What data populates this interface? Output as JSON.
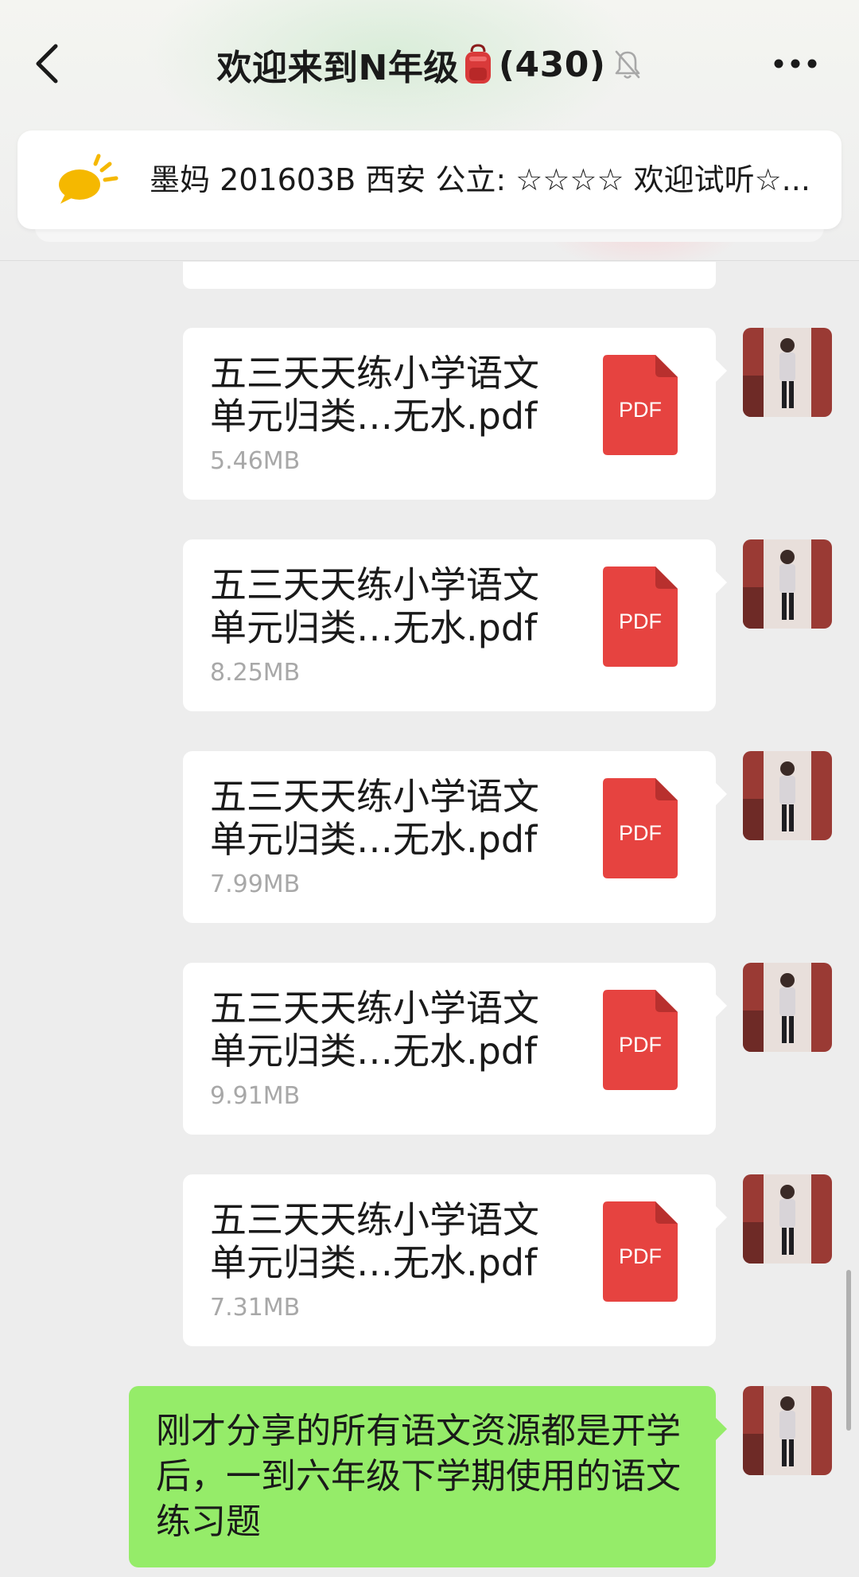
{
  "header": {
    "title": "欢迎来到N年级",
    "member_count": "(430)",
    "back_icon": "chevron-left-icon",
    "bag_icon": "backpack-emoji-icon",
    "mute_icon": "bell-muted-icon",
    "more_icon": "more-dots-icon"
  },
  "notice": {
    "icon": "announcement-bulb-icon",
    "text": "墨妈 201603B 西安 公立: ☆☆☆☆ 欢迎试听☆..."
  },
  "messages": [
    {
      "type": "file",
      "name": "五三天天练小学语文单元归类…无水.pdf",
      "size": "5.46MB",
      "file_icon": "PDF"
    },
    {
      "type": "file",
      "name": "五三天天练小学语文单元归类…无水.pdf",
      "size": "8.25MB",
      "file_icon": "PDF"
    },
    {
      "type": "file",
      "name": "五三天天练小学语文单元归类…无水.pdf",
      "size": "7.99MB",
      "file_icon": "PDF"
    },
    {
      "type": "file",
      "name": "五三天天练小学语文单元归类…无水.pdf",
      "size": "9.91MB",
      "file_icon": "PDF"
    },
    {
      "type": "file",
      "name": "五三天天练小学语文单元归类…无水.pdf",
      "size": "7.31MB",
      "file_icon": "PDF"
    },
    {
      "type": "text",
      "text": "刚才分享的所有语文资源都是开学后，一到六年级下学期使用的语文练习题"
    }
  ],
  "colors": {
    "background": "#ededed",
    "bubble_sent_text": "#95ec69",
    "bubble_file": "#ffffff",
    "pdf_red": "#e64340",
    "notice_yellow": "#f5c518",
    "file_size_gray": "#a8a8a8"
  }
}
